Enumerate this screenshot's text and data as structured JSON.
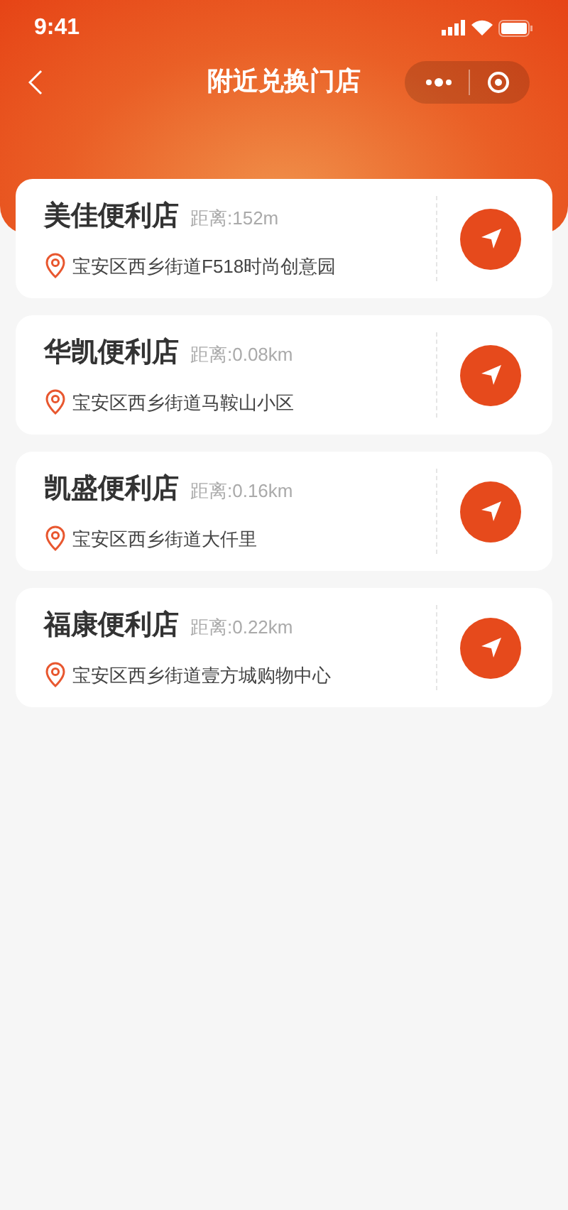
{
  "status_bar": {
    "time": "9:41"
  },
  "nav_bar": {
    "title": "附近兑换门店"
  },
  "stores": [
    {
      "name": "美佳便利店",
      "distance": "距离:152m",
      "address": "宝安区西乡街道F518时尚创意园"
    },
    {
      "name": "华凯便利店",
      "distance": "距离:0.08km",
      "address": "宝安区西乡街道马鞍山小区"
    },
    {
      "name": "凯盛便利店",
      "distance": "距离:0.16km",
      "address": "宝安区西乡街道大仟里"
    },
    {
      "name": "福康便利店",
      "distance": "距离:0.22km",
      "address": "宝安区西乡街道壹方城购物中心"
    }
  ]
}
